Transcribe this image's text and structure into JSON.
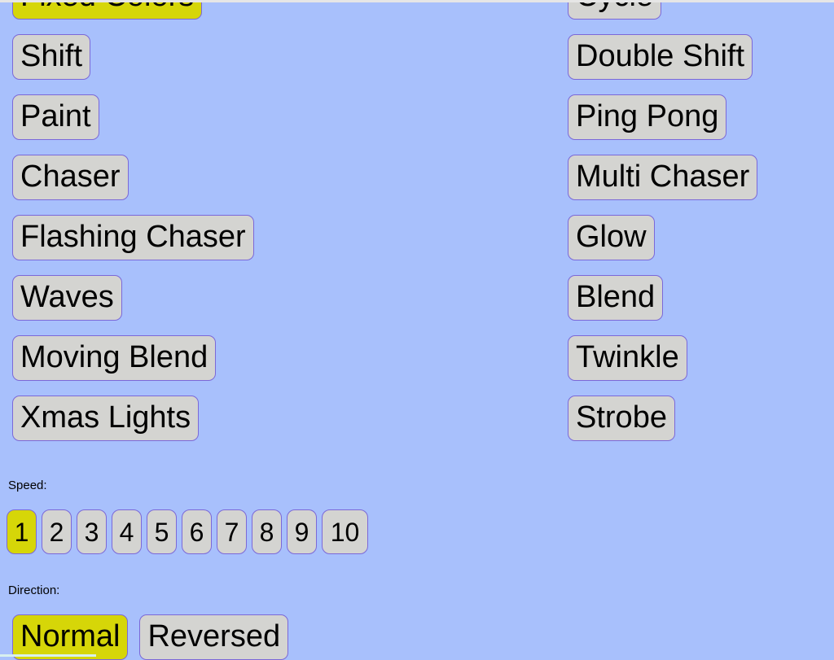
{
  "theme": {
    "background": "#a8c0fc",
    "button_fill": "#d4d4d1",
    "button_border": "#7b68d8",
    "selected_fill": "#d6d608",
    "text": "#000000"
  },
  "modes": {
    "left_column": [
      {
        "label": "Fixed Colors",
        "selected": true
      },
      {
        "label": "Shift",
        "selected": false
      },
      {
        "label": "Paint",
        "selected": false
      },
      {
        "label": "Chaser",
        "selected": false
      },
      {
        "label": "Flashing Chaser",
        "selected": false
      },
      {
        "label": "Waves",
        "selected": false
      },
      {
        "label": "Moving Blend",
        "selected": false
      },
      {
        "label": "Xmas Lights",
        "selected": false
      }
    ],
    "right_column": [
      {
        "label": "Cycle",
        "selected": false
      },
      {
        "label": "Double Shift",
        "selected": false
      },
      {
        "label": "Ping Pong",
        "selected": false
      },
      {
        "label": "Multi Chaser",
        "selected": false
      },
      {
        "label": "Glow",
        "selected": false
      },
      {
        "label": "Blend",
        "selected": false
      },
      {
        "label": "Twinkle",
        "selected": false
      },
      {
        "label": "Strobe",
        "selected": false
      }
    ]
  },
  "speed": {
    "label": "Speed:",
    "selected": "1",
    "options": [
      "1",
      "2",
      "3",
      "4",
      "5",
      "6",
      "7",
      "8",
      "9",
      "10"
    ]
  },
  "direction": {
    "label": "Direction:",
    "selected": "Normal",
    "options": [
      {
        "label": "Normal",
        "selected": true
      },
      {
        "label": "Reversed",
        "selected": false
      }
    ]
  }
}
